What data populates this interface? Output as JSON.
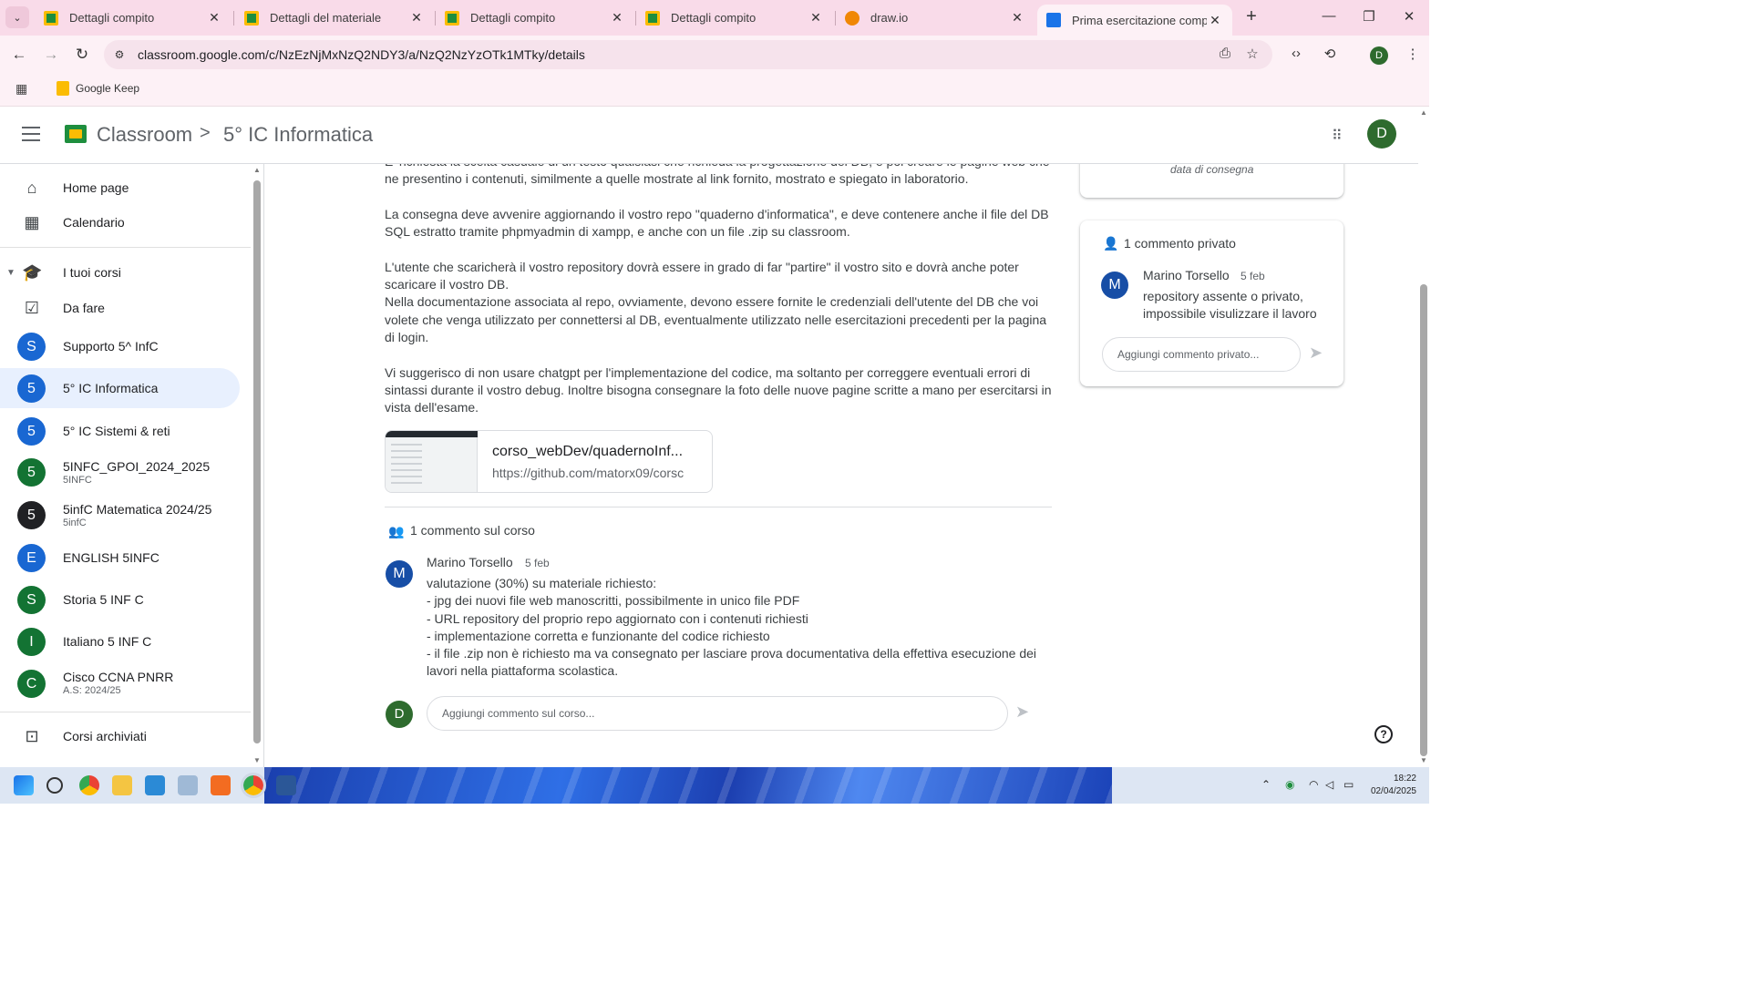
{
  "browser": {
    "tabs": [
      {
        "title": "Dettagli compito",
        "favicon": "classroom-icon"
      },
      {
        "title": "Dettagli del materiale",
        "favicon": "classroom-icon"
      },
      {
        "title": "Dettagli compito",
        "favicon": "classroom-icon"
      },
      {
        "title": "Dettagli compito",
        "favicon": "classroom-icon"
      },
      {
        "title": "draw.io",
        "favicon": "drawio-icon"
      },
      {
        "title": "Prima esercitazione completa",
        "favicon": "person-icon",
        "active": true
      }
    ],
    "url": "classroom.google.com/c/NzEzNjMxNzQ2NDY3/a/NzQ2NzYzOTk1MTky/details",
    "profile_initial": "D",
    "bookmarks": [
      {
        "label": "Google Keep"
      }
    ]
  },
  "header": {
    "brand": "Classroom",
    "course": "5° IC Informatica",
    "avatar_initial": "D"
  },
  "sidebar": {
    "top_items": [
      {
        "label": "Home page",
        "icon": "home-icon"
      },
      {
        "label": "Calendario",
        "icon": "calendar-icon"
      }
    ],
    "courses_header": "I tuoi corsi",
    "todo": "Da fare",
    "courses": [
      {
        "initial": "S",
        "label": "Supporto 5^ InfC",
        "sub": "",
        "color": "#1967d2"
      },
      {
        "initial": "5",
        "label": "5° IC Informatica",
        "sub": "",
        "color": "#1967d2",
        "selected": true
      },
      {
        "initial": "5",
        "label": "5° IC Sistemi & reti",
        "sub": "",
        "color": "#1967d2"
      },
      {
        "initial": "5",
        "label": "5INFC_GPOI_2024_2025",
        "sub": "5INFC",
        "color": "#137333"
      },
      {
        "initial": "5",
        "label": "5infC Matematica 2024/25",
        "sub": "5infC",
        "color": "#202124"
      },
      {
        "initial": "E",
        "label": "ENGLISH 5INFC",
        "sub": "",
        "color": "#1967d2"
      },
      {
        "initial": "S",
        "label": "Storia 5 INF C",
        "sub": "",
        "color": "#137333"
      },
      {
        "initial": "I",
        "label": "Italiano 5 INF C",
        "sub": "",
        "color": "#137333"
      },
      {
        "initial": "C",
        "label": "Cisco CCNA PNRR",
        "sub": "A.S: 2024/25",
        "color": "#137333"
      }
    ],
    "archived": "Corsi archiviati"
  },
  "assignment": {
    "description": [
      "E' richiesta la scelta casuale di un testo qualsiasi che richieda la progettazione del DB, e poi creare le pagine web che ne presentino i contenuti, similmente a quelle mostrate al link fornito, mostrato e spiegato in laboratorio.",
      "La consegna deve avvenire aggiornando il vostro repo \"quaderno d'informatica\", e deve contenere anche il file del DB SQL estratto tramite phpmyadmin di xampp, e anche con un file .zip su classroom.",
      "L'utente che scaricherà il vostro repository dovrà essere in grado di far \"partire\" il vostro sito e dovrà anche poter scaricare il vostro DB.",
      "Nella documentazione associata al repo, ovviamente, devono essere fornite le credenziali dell'utente del DB che voi volete che venga utilizzato per connettersi al DB, eventualmente utilizzato nelle esercitazioni precedenti per la pagina di login.",
      "Vi suggerisco di non usare chatgpt per l'implementazione del codice, ma soltanto per correggere eventuali errori di sintassi durante il vostro debug. Inoltre bisogna consegnare la foto delle nuove pagine scritte a mano per esercitarsi in vista dell'esame."
    ],
    "attachment": {
      "title": "corso_webDev/quadernoInf...",
      "url": "https://github.com/matorx09/corsc"
    },
    "class_comments": {
      "header": "1 commento sul corso",
      "items": [
        {
          "initial": "M",
          "author": "Marino Torsello",
          "date": "5 feb",
          "lines": [
            "valutazione (30%) su materiale richiesto:",
            "- jpg dei nuovi file web manoscritti, possibilmente in unico file PDF",
            "- URL repository del proprio repo aggiornato con i contenuti richiesti",
            "- implementazione corretta e funzionante del codice richiesto",
            "- il file .zip non è richiesto ma va consegnato per lasciare prova documentativa della effettiva esecuzione dei lavori nella piattaforma scolastica."
          ]
        }
      ],
      "input_placeholder": "Aggiungi commento sul corso...",
      "user_initial": "D"
    }
  },
  "side_cards": {
    "due_text": "data di consegna",
    "private": {
      "header": "1 commento privato",
      "initial": "M",
      "author": "Marino Torsello",
      "date": "5 feb",
      "body": "repository assente o privato, impossibile visulizzare il lavoro",
      "input_placeholder": "Aggiungi commento privato..."
    }
  },
  "help": "?",
  "taskbar": {
    "time": "18:22",
    "date": "02/04/2025"
  }
}
